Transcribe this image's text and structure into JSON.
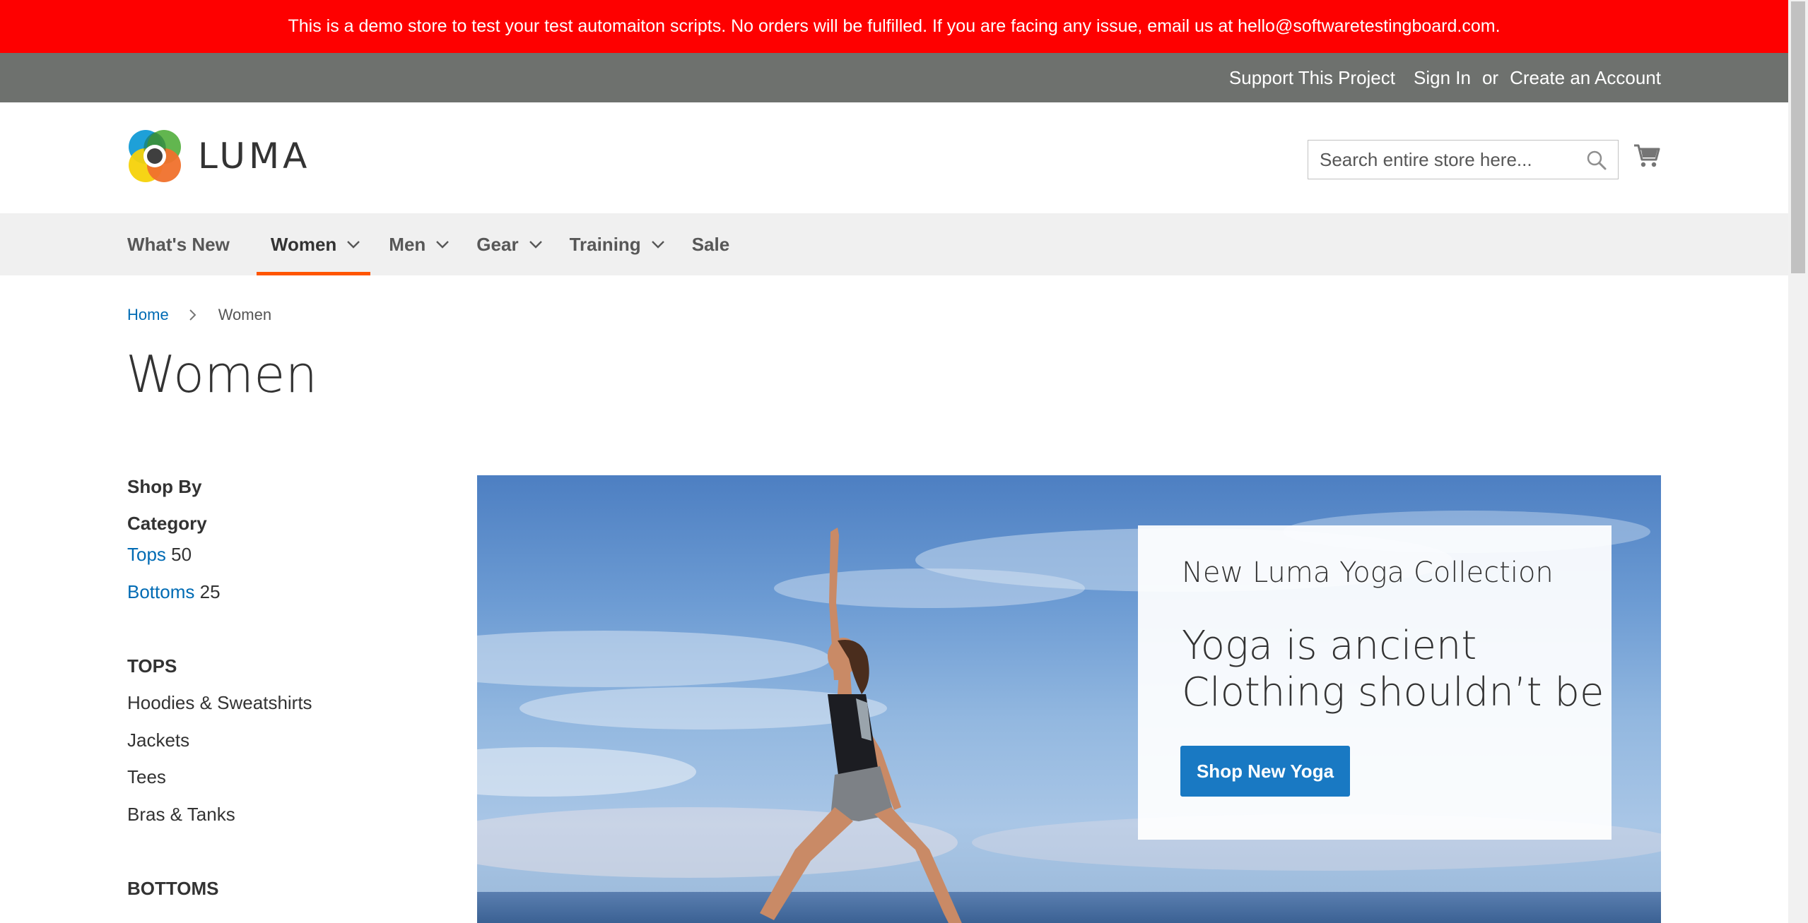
{
  "notice": {
    "text": "This is a demo store to test your test automaiton scripts. No orders will be fulfilled. If you are facing any issue, email us at hello@softwaretestingboard.com."
  },
  "top_links": {
    "support": "Support This Project",
    "sign_in": "Sign In",
    "or": "or",
    "create_account": "Create an Account"
  },
  "header": {
    "logo_text": "LUMA",
    "search_placeholder": "Search entire store here..."
  },
  "nav": {
    "items": [
      {
        "label": "What's New",
        "has_dropdown": false,
        "active": false
      },
      {
        "label": "Women",
        "has_dropdown": true,
        "active": true
      },
      {
        "label": "Men",
        "has_dropdown": true,
        "active": false
      },
      {
        "label": "Gear",
        "has_dropdown": true,
        "active": false
      },
      {
        "label": "Training",
        "has_dropdown": true,
        "active": false
      },
      {
        "label": "Sale",
        "has_dropdown": false,
        "active": false
      }
    ]
  },
  "breadcrumb": {
    "home": "Home",
    "current": "Women"
  },
  "page_title": "Women",
  "sidebar": {
    "shop_by": "Shop By",
    "category_heading": "Category",
    "categories": [
      {
        "label": "Tops",
        "count": "50"
      },
      {
        "label": "Bottoms",
        "count": "25"
      }
    ],
    "tops_heading": "TOPS",
    "tops": [
      "Hoodies & Sweatshirts",
      "Jackets",
      "Tees",
      "Bras & Tanks"
    ],
    "bottoms_heading": "BOTTOMS"
  },
  "promo": {
    "subtitle": "New Luma Yoga Collection",
    "title_line1": "Yoga is ancient",
    "title_line2": "Clothing shouldn’t be",
    "button": "Shop New Yoga"
  },
  "colors": {
    "notice_bg": "#fe0000",
    "top_panel_bg": "#6e716e",
    "nav_bg": "#f0f0f0",
    "nav_active_underline": "#ff5501",
    "link": "#006bb4",
    "button": "#1979c3"
  },
  "icons": {
    "search": "search-icon",
    "cart": "cart-icon",
    "dropdown": "chevron-down-icon",
    "breadcrumb_separator": "chevron-right-icon"
  }
}
